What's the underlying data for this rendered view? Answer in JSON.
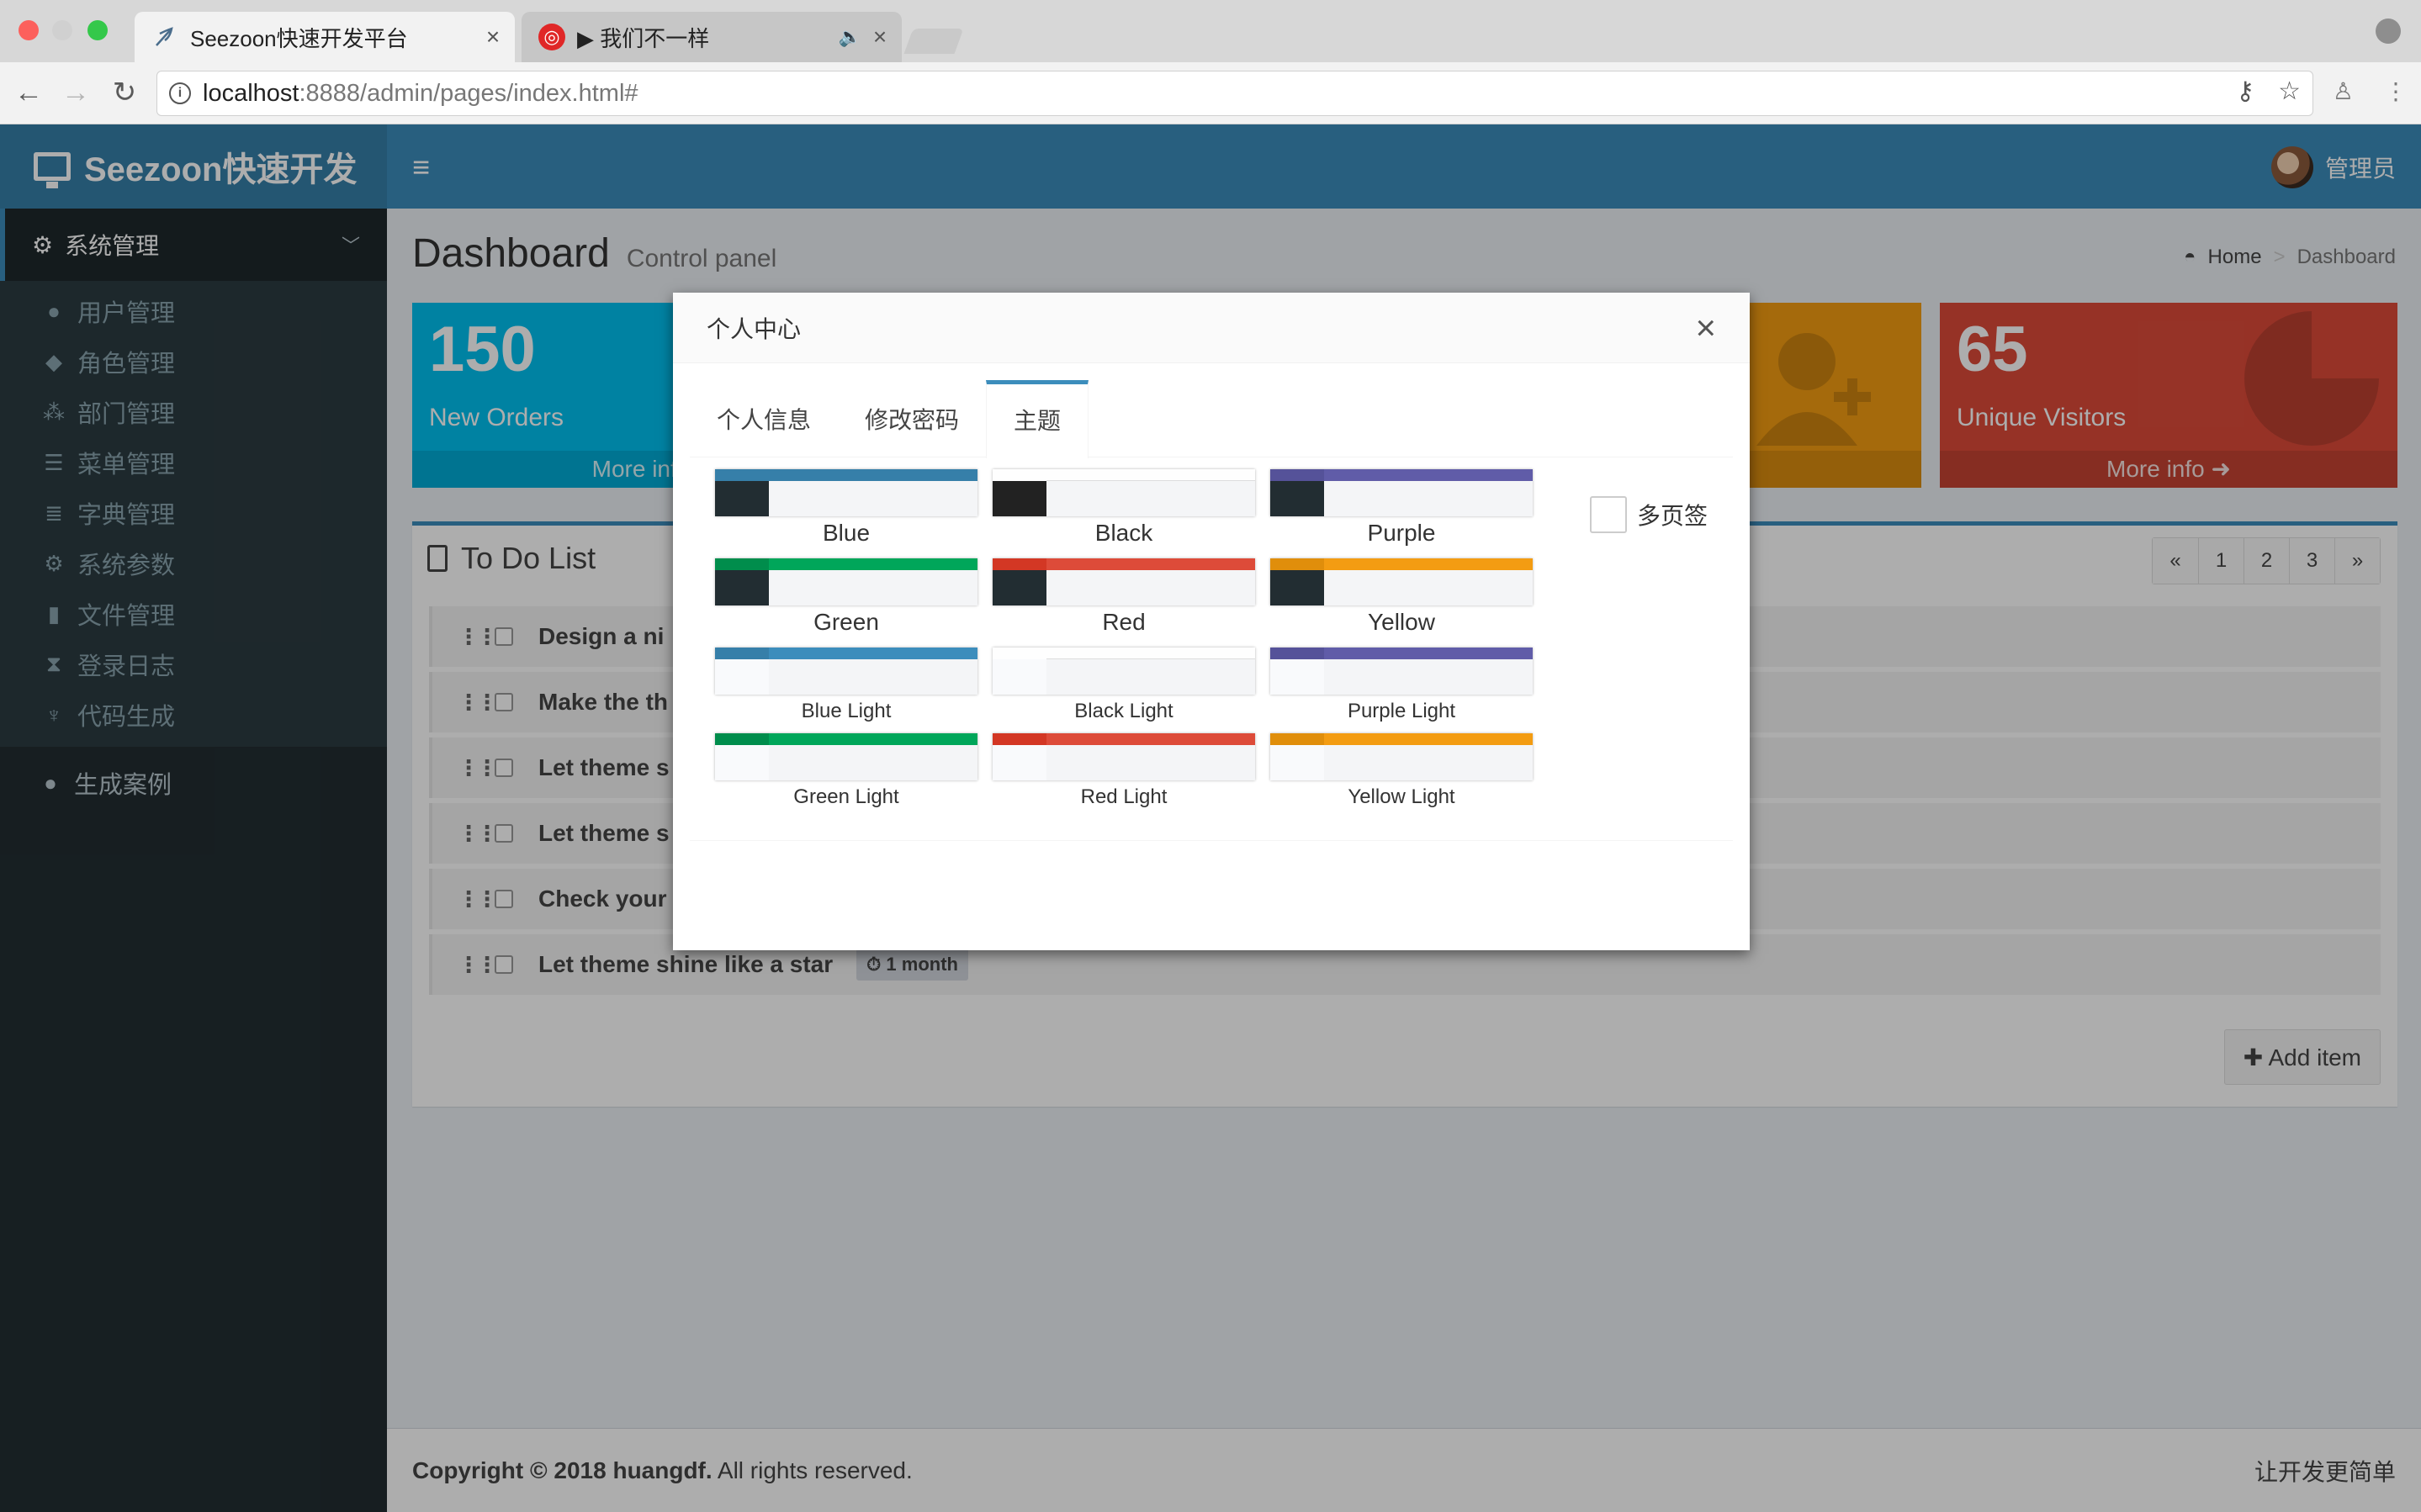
{
  "browser": {
    "tabs": [
      {
        "title": "Seezoon快速开发平台",
        "close": "×"
      },
      {
        "title": "▶ 我们不一样",
        "close": "×"
      }
    ],
    "url_host": "localhost",
    "url_path": ":8888/admin/pages/index.html#"
  },
  "sidebar": {
    "logo": "Seezoon快速开发",
    "group_label": "系统管理",
    "items": [
      {
        "label": "用户管理",
        "icon": "user-icon"
      },
      {
        "label": "角色管理",
        "icon": "user-secret-icon"
      },
      {
        "label": "部门管理",
        "icon": "sitemap-icon"
      },
      {
        "label": "菜单管理",
        "icon": "menu-icon"
      },
      {
        "label": "字典管理",
        "icon": "database-icon"
      },
      {
        "label": "系统参数",
        "icon": "settings-icon"
      },
      {
        "label": "文件管理",
        "icon": "file-icon"
      },
      {
        "label": "登录日志",
        "icon": "hourglass-icon"
      },
      {
        "label": "代码生成",
        "icon": "code-icon"
      }
    ],
    "case_label": "生成案例"
  },
  "header": {
    "user_name": "管理员"
  },
  "content": {
    "title": "Dashboard",
    "subtitle": "Control panel",
    "breadcrumb_home": "Home",
    "breadcrumb_current": "Dashboard",
    "boxes": {
      "orders": {
        "number": "150",
        "label": "New Orders",
        "more": "More info"
      },
      "visitors": {
        "number": "65",
        "label": "Unique Visitors",
        "more": "More info ➜"
      }
    },
    "todo": {
      "title": "To Do List",
      "pager": [
        "«",
        "1",
        "2",
        "3",
        "»"
      ],
      "items": [
        {
          "text": "Design a ni"
        },
        {
          "text": "Make the th"
        },
        {
          "text": "Let theme s"
        },
        {
          "text": "Let theme s"
        },
        {
          "text": "Check your"
        },
        {
          "text": "Let theme shine like a star",
          "badge": "⏱ 1 month"
        }
      ],
      "add_label": "✚ Add item"
    }
  },
  "footer": {
    "copyright_bold": "Copyright © 2018 huangdf.",
    "copyright_rest": " All rights reserved.",
    "slogan": "让开发更简单"
  },
  "modal": {
    "title": "个人中心",
    "close": "×",
    "tabs": [
      "个人信息",
      "修改密码",
      "主题"
    ],
    "active_tab": "主题",
    "multi_tab_label": "多页签",
    "skins": [
      {
        "label": "Blue",
        "top": "#367fa9",
        "logo": "#367fa9",
        "side": "#222d32"
      },
      {
        "label": "Black",
        "top": "#fefefe",
        "logo": "#fefefe",
        "side": "#222222"
      },
      {
        "label": "Purple",
        "top": "#605ca8",
        "logo": "#555299",
        "side": "#222d32"
      },
      {
        "label": "Green",
        "top": "#00a65a",
        "logo": "#008d4c",
        "side": "#222d32"
      },
      {
        "label": "Red",
        "top": "#dd4b39",
        "logo": "#d33724",
        "side": "#222d32"
      },
      {
        "label": "Yellow",
        "top": "#f39c12",
        "logo": "#e08e0b",
        "side": "#222d32"
      },
      {
        "label": "Blue Light",
        "top": "#3c8dbc",
        "logo": "#367fa9",
        "side": "#f9fafc"
      },
      {
        "label": "Black Light",
        "top": "#fefefe",
        "logo": "#fefefe",
        "side": "#f9fafc"
      },
      {
        "label": "Purple Light",
        "top": "#605ca8",
        "logo": "#555299",
        "side": "#f9fafc"
      },
      {
        "label": "Green Light",
        "top": "#00a65a",
        "logo": "#008d4c",
        "side": "#f9fafc"
      },
      {
        "label": "Red Light",
        "top": "#dd4b39",
        "logo": "#d33724",
        "side": "#f9fafc"
      },
      {
        "label": "Yellow Light",
        "top": "#f39c12",
        "logo": "#e08e0b",
        "side": "#f9fafc"
      }
    ]
  },
  "colors": {
    "accent": "#3c8dbc",
    "sidebar": "#222d32",
    "aqua": "#00c0ef",
    "yellow": "#f39c12",
    "red": "#dd4b39"
  }
}
